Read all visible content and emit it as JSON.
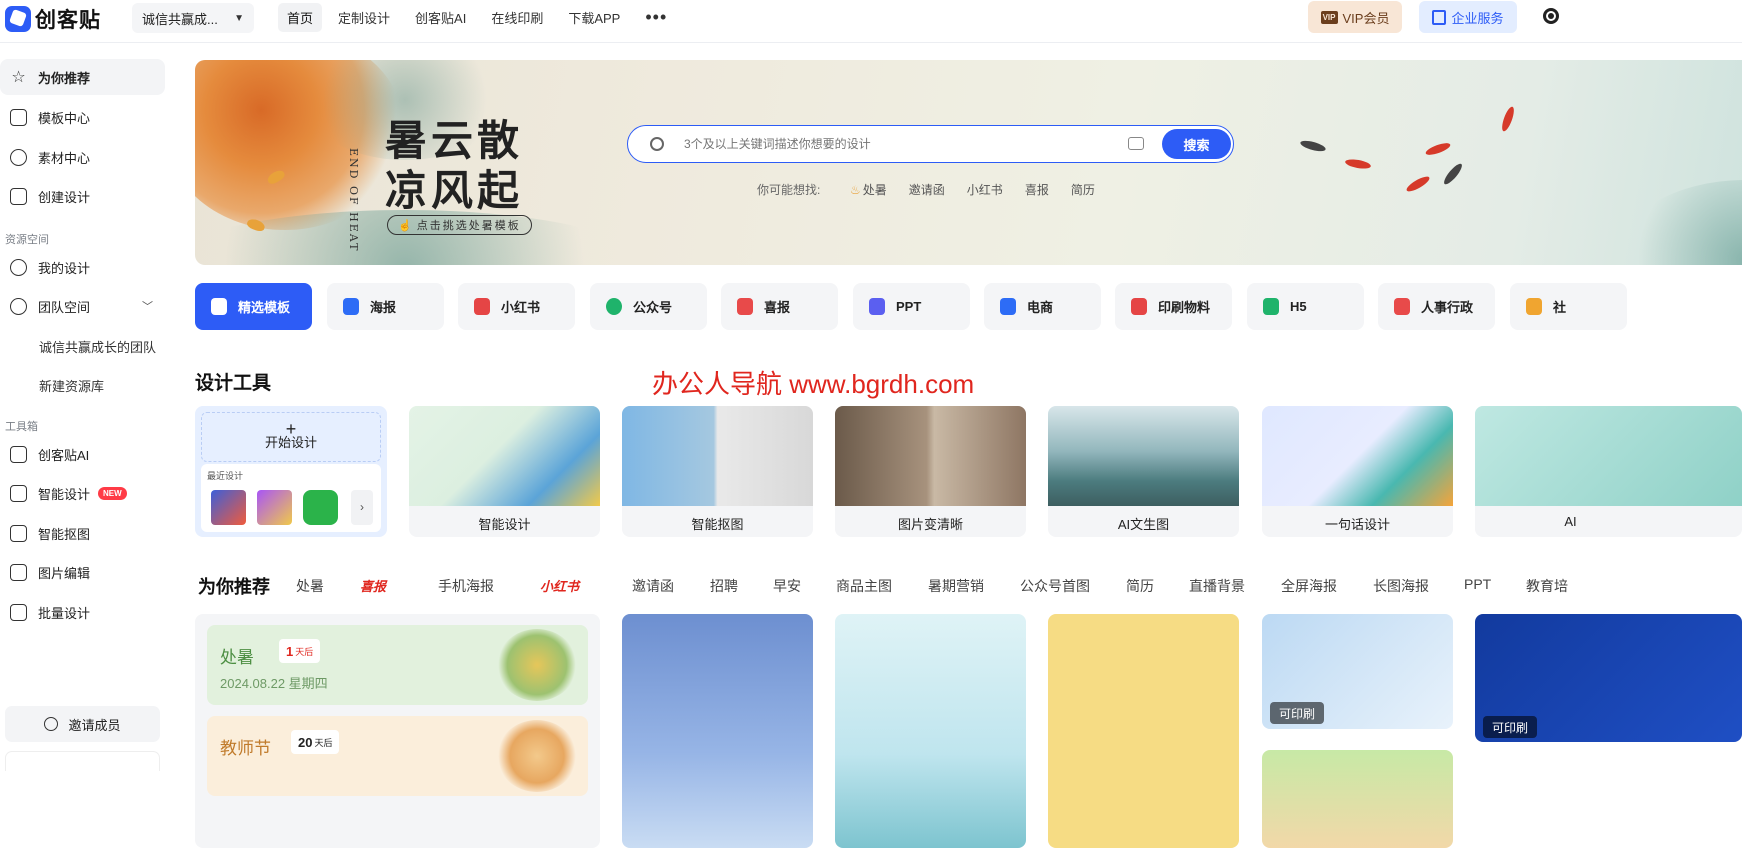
{
  "header": {
    "logo_text": "创客贴",
    "team_name": "诚信共赢成...",
    "nav": [
      "首页",
      "定制设计",
      "创客贴AI",
      "在线印刷",
      "下载APP"
    ],
    "more": "•••",
    "vip_label": "VIP会员",
    "vip_icon_text": "VIP",
    "enterprise_label": "企业服务"
  },
  "sidebar": {
    "items": [
      {
        "label": "为你推荐",
        "icon": "star-icon"
      },
      {
        "label": "模板中心",
        "icon": "template-icon"
      },
      {
        "label": "素材中心",
        "icon": "material-icon"
      },
      {
        "label": "创建设计",
        "icon": "create-icon"
      }
    ],
    "section_resources": "资源空间",
    "my_design": "我的设计",
    "team_space": "团队空间",
    "team_sub": "诚信共赢成长的团队",
    "new_library": "新建资源库",
    "section_tools": "工具箱",
    "tools": [
      {
        "label": "创客贴AI",
        "icon": "ai-icon"
      },
      {
        "label": "智能设计",
        "icon": "smart-design-icon",
        "badge": "NEW"
      },
      {
        "label": "智能抠图",
        "icon": "cutout-icon"
      },
      {
        "label": "图片编辑",
        "icon": "crop-icon"
      },
      {
        "label": "批量设计",
        "icon": "batch-icon"
      }
    ],
    "invite": "邀请成员"
  },
  "banner": {
    "vertical_text": "END OF HEAT",
    "title_line1": "暑云散",
    "title_line2": "凉风起",
    "pill": "点击挑选处暑模板",
    "search_placeholder": "3个及以上关键词描述你想要的设计",
    "search_button": "搜索",
    "hot_label": "你可能想找:",
    "hot_words": [
      "处暑",
      "邀请函",
      "小红书",
      "喜报",
      "简历"
    ]
  },
  "categories": [
    {
      "label": "精选模板",
      "color": "#ffffff"
    },
    {
      "label": "海报",
      "color": "#2d6cf6"
    },
    {
      "label": "小红书",
      "color": "#e54545"
    },
    {
      "label": "公众号",
      "color": "#1fb36b"
    },
    {
      "label": "喜报",
      "color": "#e84a4a"
    },
    {
      "label": "PPT",
      "color": "#5b5ff0"
    },
    {
      "label": "电商",
      "color": "#2d6cf6"
    },
    {
      "label": "印刷物料",
      "color": "#e54545"
    },
    {
      "label": "H5",
      "color": "#1fb36b"
    },
    {
      "label": "人事行政",
      "color": "#e84a4a"
    },
    {
      "label": "社",
      "color": "#f0a530"
    }
  ],
  "watermark": "办公人导航 www.bgrdh.com",
  "tools_section": {
    "title": "设计工具",
    "start": "开始设计",
    "recent": "最近设计",
    "tools": [
      "智能设计",
      "智能抠图",
      "图片变清晰",
      "AI文生图",
      "一句话设计",
      "AI"
    ]
  },
  "recommend": {
    "title": "为你推荐",
    "tabs": [
      "处暑",
      "喜报",
      "手机海报",
      "小红书",
      "邀请函",
      "招聘",
      "早安",
      "商品主图",
      "暑期营销",
      "公众号首图",
      "简历",
      "直播背景",
      "全屏海报",
      "长图海报",
      "PPT",
      "教育培"
    ]
  },
  "holidays": [
    {
      "name": "处暑",
      "days": "1",
      "unit": "天后",
      "date": "2024.08.22 星期四"
    },
    {
      "name": "教师节",
      "days": "20",
      "unit": "天后",
      "date": ""
    }
  ],
  "templates": {
    "print_badge": "可印刷"
  }
}
